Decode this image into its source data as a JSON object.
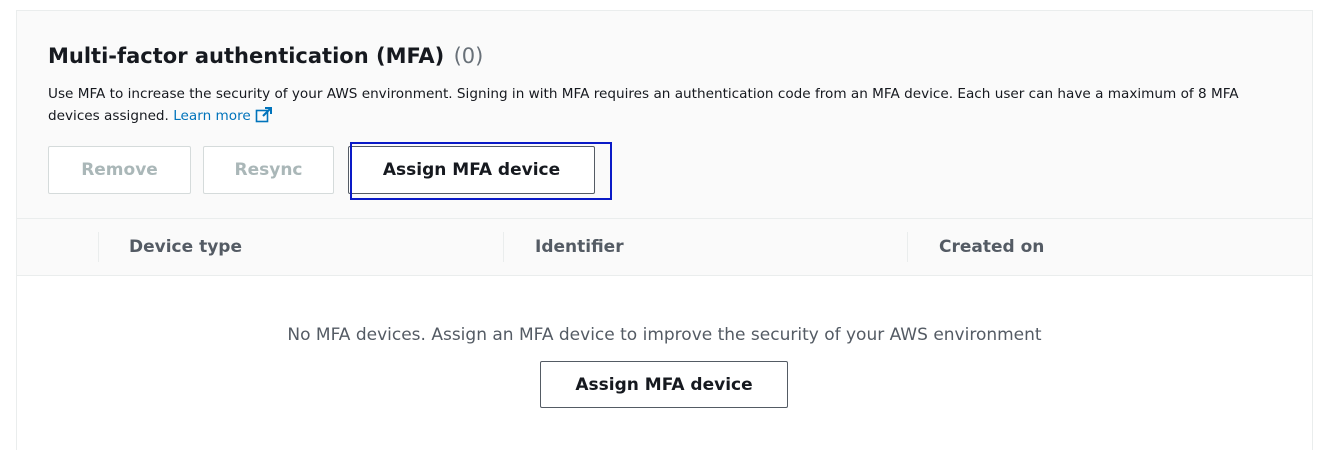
{
  "mfa": {
    "title": "Multi-factor authentication (MFA)",
    "count": "(0)",
    "description": "Use MFA to increase the security of your AWS environment. Signing in with MFA requires an authentication code from an MFA device. Each user can have a maximum of 8 MFA devices assigned.",
    "learn_more": "Learn more",
    "actions": {
      "remove_label": "Remove",
      "resync_label": "Resync",
      "assign_label": "Assign MFA device"
    },
    "table": {
      "columns": [
        "Device type",
        "Identifier",
        "Created on"
      ]
    },
    "empty": {
      "message": "No MFA devices. Assign an MFA device to improve the security of your AWS environment",
      "assign_label": "Assign MFA device"
    }
  },
  "colors": {
    "link": "#0073bb",
    "focus_ring": "#0a1ac7",
    "disabled_text": "#aab7b8"
  },
  "icons": {
    "external_link": "external-link-icon"
  }
}
